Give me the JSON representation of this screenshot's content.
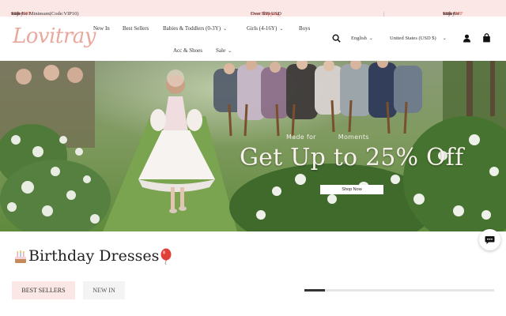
{
  "announcement": {
    "promo_left": {
      "prefix": "Enjoy ",
      "highlight": "10% OFF",
      "suffix": " with No Minimum(Code:VIP10)"
    },
    "promo_center": {
      "highlight": "Free Shipping",
      "suffix": " Over $99 USD"
    },
    "promo_right": {
      "prefix": "Enjoy ",
      "highlight": "10% OFF",
      "suffix": " with No"
    },
    "highlight_color": "#e0483d",
    "background_color": "#fbe8e6"
  },
  "header": {
    "logo_text": "Lovitray",
    "logo_mark": "®",
    "logo_color": "#e9a89d",
    "nav": [
      {
        "label": "New In",
        "has_dropdown": false
      },
      {
        "label": "Best Sellers",
        "has_dropdown": false
      },
      {
        "label": "Babies & Toddlers (0-3Y)",
        "has_dropdown": true
      },
      {
        "label": "Girls (4-16Y)",
        "has_dropdown": true
      },
      {
        "label": "Boys",
        "has_dropdown": false
      },
      {
        "label": "Acc & Shoes",
        "has_dropdown": false
      },
      {
        "label": "Sale",
        "has_dropdown": true
      }
    ],
    "language": "English",
    "region": "United States  (USD $)",
    "icons": [
      "search-icon",
      "user-icon",
      "cart-icon"
    ]
  },
  "hero": {
    "made_prefix": "Made for",
    "made_suffix": "Moments",
    "headline": "Get Up to 25% Off",
    "cta_label": "Shop Now"
  },
  "section": {
    "emoji_left": "cake-icon",
    "title": "Birthday Dresses",
    "emoji_right": "balloon-icon",
    "tabs": [
      {
        "label": "BEST SELLERS",
        "active": true
      },
      {
        "label": "NEW IN",
        "active": false
      }
    ],
    "carousel_progress": 0.11
  },
  "chat": {
    "icon": "chat-icon"
  }
}
